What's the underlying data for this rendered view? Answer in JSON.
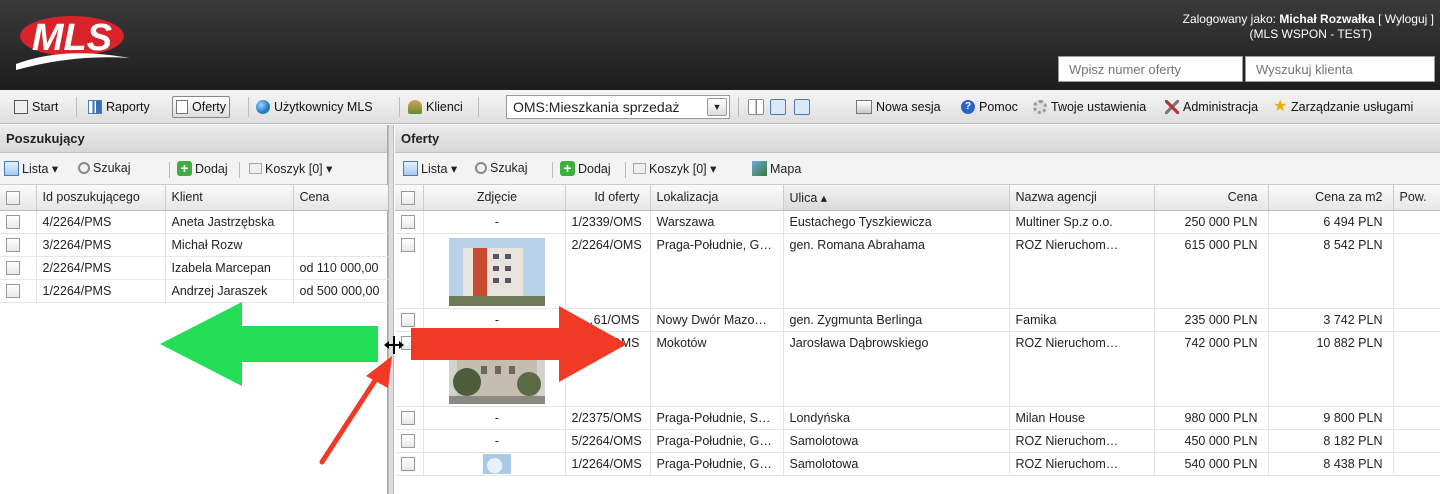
{
  "header": {
    "logo_text": "MLS",
    "login_prefix": "Zalogowany jako:",
    "user_name": "Michał Rozwałka",
    "logout": "[ Wyloguj ]",
    "org": "(MLS WSPON - TEST)",
    "offer_placeholder": "Wpisz numer oferty",
    "client_placeholder": "Wyszukuj klienta"
  },
  "toolbar": {
    "start": "Start",
    "raporty": "Raporty",
    "oferty": "Oferty",
    "uzytkownicy": "Użytkownicy MLS",
    "klienci": "Klienci",
    "view_select": "OMS:Mieszkania sprzedaż",
    "nowa_sesja": "Nowa sesja",
    "pomoc": "Pomoc",
    "ustawienia": "Twoje ustawienia",
    "administracja": "Administracja",
    "uslugi": "Zarządzanie usługami"
  },
  "left": {
    "title": "Poszukujący",
    "toolbar": {
      "lista": "Lista ▾",
      "szukaj": "Szukaj",
      "dodaj": "Dodaj",
      "koszyk": "Koszyk [0] ▾"
    },
    "columns": [
      "Id poszukującego",
      "Klient",
      "Cena"
    ],
    "rows": [
      {
        "id": "4/2264/PMS",
        "klient": "Aneta Jastrzębska",
        "cena": ""
      },
      {
        "id": "3/2264/PMS",
        "klient": "Michał Rozw",
        "cena": ""
      },
      {
        "id": "2/2264/PMS",
        "klient": "Izabela Marcepan",
        "cena": "od 110 000,00"
      },
      {
        "id": "1/2264/PMS",
        "klient": "Andrzej Jaraszek",
        "cena": "od 500 000,00"
      }
    ]
  },
  "right": {
    "title": "Oferty",
    "toolbar": {
      "lista": "Lista ▾",
      "szukaj": "Szukaj",
      "dodaj": "Dodaj",
      "koszyk": "Koszyk [0] ▾",
      "mapa": "Mapa"
    },
    "columns": [
      "Zdjęcie",
      "Id oferty",
      "Lokalizacja",
      "Ulica ▴",
      "Nazwa agencji",
      "Cena",
      "Cena za m2",
      "Pow."
    ],
    "rows": [
      {
        "zdjecie": "-",
        "id": "1/2339/OMS",
        "lok": "Warszawa",
        "ulica": "Eustachego Tyszkiewicza",
        "agencja": "Multiner Sp.z o.o.",
        "cena": "250 000 PLN",
        "m2": "6 494 PLN",
        "photo": false
      },
      {
        "zdjecie": "",
        "id": "2/2264/OMS",
        "lok": "Praga-Południe, G…",
        "ulica": "gen. Romana Abrahama",
        "agencja": "ROZ Nieruchom…",
        "cena": "615 000 PLN",
        "m2": "8 542 PLN",
        "photo": true
      },
      {
        "zdjecie": "-",
        "id": "…61/OMS",
        "lok": "Nowy Dwór Mazo…",
        "ulica": "gen. Zygmunta Berlinga",
        "agencja": "Famika",
        "cena": "235 000 PLN",
        "m2": "3 742 PLN",
        "photo": false
      },
      {
        "zdjecie": "",
        "id": "…/OMS",
        "lok": "Mokotów",
        "ulica": "Jarosława Dąbrowskiego",
        "agencja": "ROZ Nieruchom…",
        "cena": "742 000 PLN",
        "m2": "10 882 PLN",
        "photo": true
      },
      {
        "zdjecie": "-",
        "id": "2/2375/OMS",
        "lok": "Praga-Południe, S…",
        "ulica": "Londyńska",
        "agencja": "Milan House",
        "cena": "980 000 PLN",
        "m2": "9 800 PLN",
        "photo": false
      },
      {
        "zdjecie": "-",
        "id": "5/2264/OMS",
        "lok": "Praga-Południe, G…",
        "ulica": "Samolotowa",
        "agencja": "ROZ Nieruchom…",
        "cena": "450 000 PLN",
        "m2": "8 182 PLN",
        "photo": false
      },
      {
        "zdjecie": "",
        "id": "1/2264/OMS",
        "lok": "Praga-Południe, G…",
        "ulica": "Samolotowa",
        "agencja": "ROZ Nieruchom…",
        "cena": "540 000 PLN",
        "m2": "8 438 PLN",
        "photo": true
      }
    ]
  },
  "colors": {
    "logo_red": "#d8232a",
    "green_arrow": "#22dd55",
    "red_arrow": "#f03a25"
  }
}
